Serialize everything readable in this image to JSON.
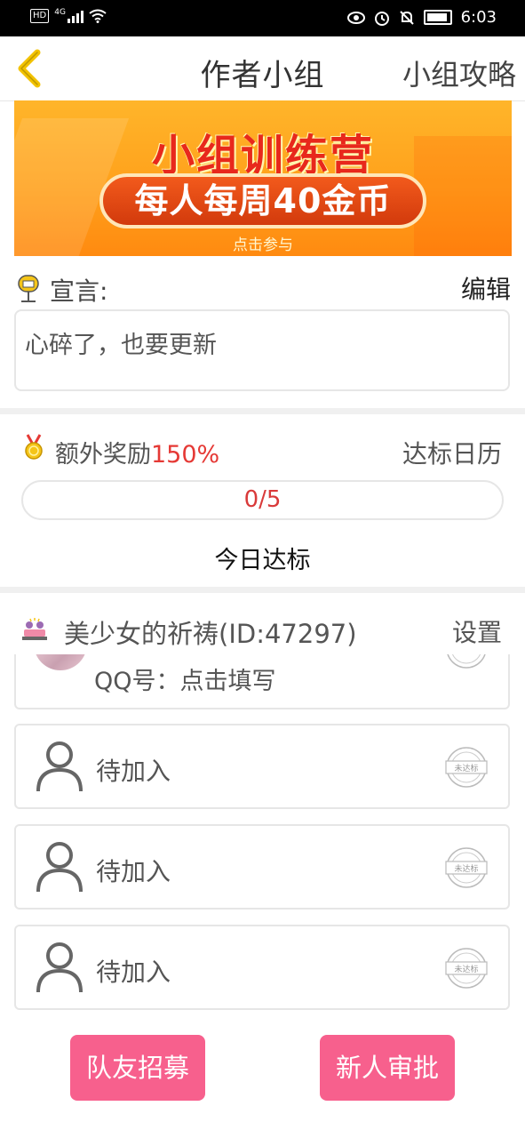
{
  "status_bar": {
    "network_badge": "HD",
    "network_type": "4G",
    "time": "6:03"
  },
  "nav": {
    "title": "作者小组",
    "right_link": "小组攻略"
  },
  "banner": {
    "title": "小组训练营",
    "pill_text": "每人每周40金币",
    "sub_text": "点击参与"
  },
  "manifesto": {
    "label": "宣言:",
    "edit_label": "编辑",
    "text": "心碎了，也要更新"
  },
  "reward": {
    "label": "额外奖励",
    "percent": "150%",
    "calendar_link": "达标日历",
    "progress_text": "0/5",
    "progress_fraction": 0,
    "today_label": "今日达标"
  },
  "group": {
    "name": "美少女的祈祷(ID:47297)",
    "settings_label": "设置",
    "member": {
      "qq_text": "QQ号：点击填写"
    },
    "slots": [
      {
        "label": "待加入",
        "stamp": "未达标"
      },
      {
        "label": "待加入",
        "stamp": "未达标"
      },
      {
        "label": "待加入",
        "stamp": "未达标"
      }
    ]
  },
  "actions": {
    "recruit": "队友招募",
    "approve": "新人审批"
  },
  "colors": {
    "accent_pink": "#f7608d",
    "highlight_red": "#e53935",
    "back_arrow": "#f2c200"
  }
}
